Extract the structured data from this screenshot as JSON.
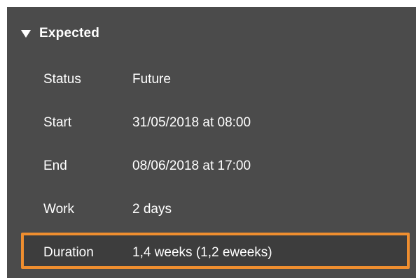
{
  "section": {
    "title": "Expected",
    "icon": "disclosure-triangle-down-icon"
  },
  "rows": [
    {
      "label": "Status",
      "value": "Future"
    },
    {
      "label": "Start",
      "value": "31/05/2018 at 08:00"
    },
    {
      "label": "End",
      "value": "08/06/2018 at 17:00"
    },
    {
      "label": "Work",
      "value": "2 days"
    },
    {
      "label": "Duration",
      "value": "1,4 weeks (1,2 eweeks)"
    }
  ],
  "colors": {
    "panel_background": "#4b4b4b",
    "text": "#ffffff",
    "highlight_border": "#ef8e2f"
  }
}
